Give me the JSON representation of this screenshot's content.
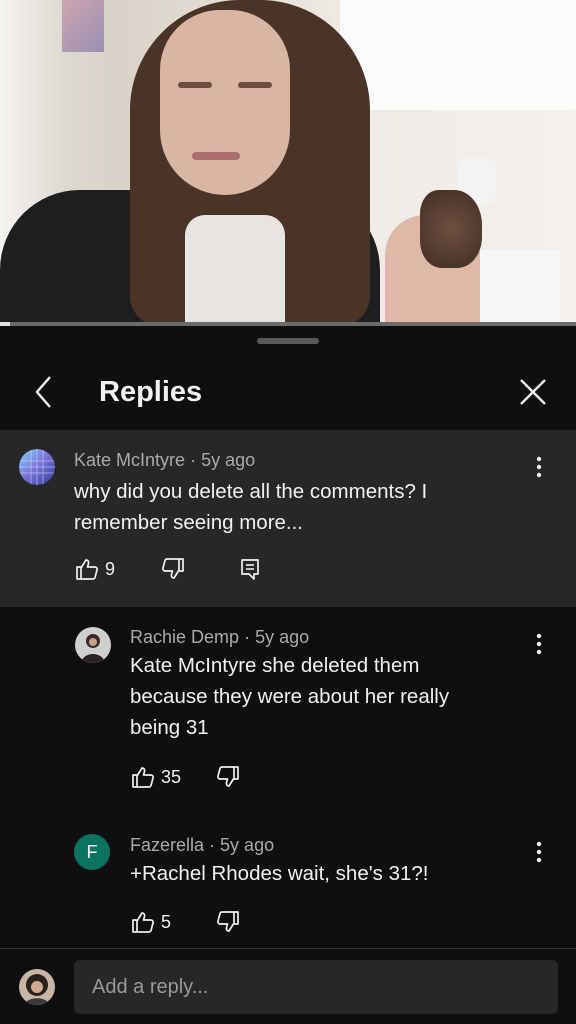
{
  "video": {
    "progress": 0.017
  },
  "header": {
    "title": "Replies"
  },
  "comments": [
    {
      "author": "Kate McIntyre",
      "age": "5y ago",
      "text_line1": "why did you delete all the comments? I",
      "text_line2": "remember seeing more...",
      "likes": "9"
    },
    {
      "author": "Rachie Demp",
      "age": "5y ago",
      "text_line1": "Kate McIntyre she deleted them",
      "text_line2": "because they were about her really",
      "text_line3": "being 31",
      "likes": "35"
    },
    {
      "author": "Fazerella",
      "age": "5y ago",
      "avatar_letter": "F",
      "text_line1": "+Rachel Rhodes wait, she's 31?!",
      "likes": "5"
    }
  ],
  "reply_box": {
    "placeholder": "Add a reply..."
  },
  "colors": {
    "background": "#0f0f0f",
    "highlight": "#272727",
    "meta": "#aaaaaa",
    "fazerella_avatar": "#0d7361"
  },
  "icons": [
    "back-chevron-icon",
    "close-icon",
    "thumbs-up-icon",
    "thumbs-down-icon",
    "reply-comment-icon",
    "more-vert-icon"
  ]
}
